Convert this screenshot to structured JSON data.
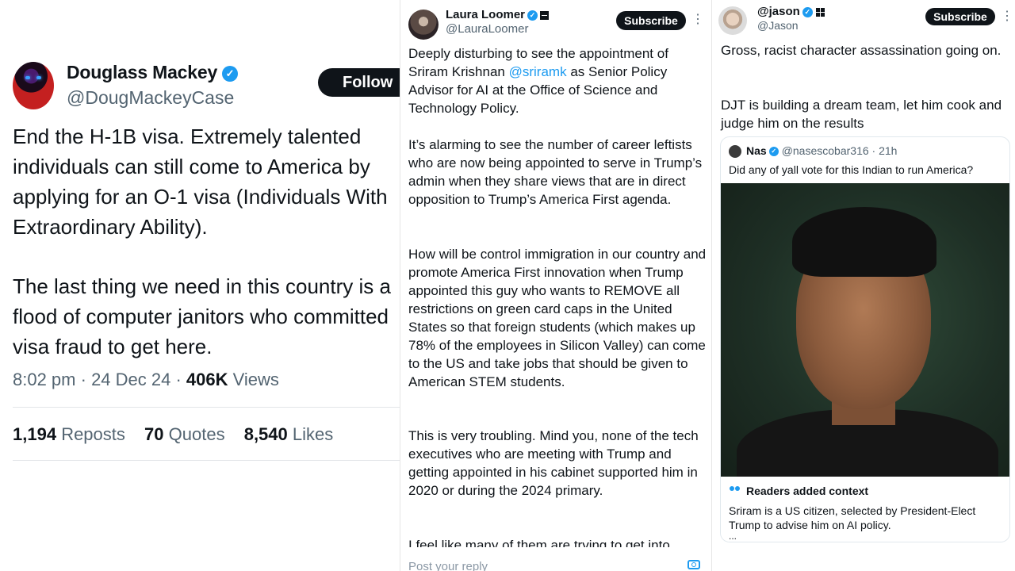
{
  "panel1": {
    "author_name": "Douglass Mackey",
    "author_handle": "@DougMackeyCase",
    "follow_label": "Follow",
    "text_paragraph_1": "End the H-1B visa. Extremely talented individuals can still come to America by applying for an O-1 visa (Individuals With Extraordinary Ability).",
    "text_paragraph_2": "The last thing we need in this country is a flood of computer janitors who committed visa fraud to get here.",
    "meta_time": "8:02 pm",
    "meta_date": "24 Dec 24",
    "views_count": "406K",
    "views_label": "Views",
    "reposts_count": "1,194",
    "reposts_label": "Reposts",
    "quotes_count": "70",
    "quotes_label": "Quotes",
    "likes_count": "8,540",
    "likes_label": "Likes"
  },
  "panel2": {
    "author_name": "Laura Loomer",
    "author_handle": "@LauraLoomer",
    "subscribe_label": "Subscribe",
    "p1_before": "Deeply disturbing to see the appointment of Sriram Krishnan ",
    "p1_mention": "@sriramk",
    "p1_after": " as Senior Policy Advisor for AI at the Office of Science and Technology Policy.",
    "p2": "It’s alarming to see the number of career leftists who are now being appointed to serve in Trump’s admin when they share views that are in direct opposition to Trump’s America First agenda.",
    "p3": "How will be control immigration in our country and promote America First innovation when Trump appointed this guy who wants to REMOVE all restrictions on green card caps in the United States so that foreign students (which makes up 78% of the employees in Silicon Valley) can come to the US and take jobs that should be given to American STEM students.",
    "p4": "This is very troubling. Mind you, none of the tech executives who are meeting with Trump and getting appointed in his cabinet supported him in 2020 or during the 2024 primary.",
    "p5": "I feel like many of them are trying to get into",
    "reply_placeholder": "Post your reply"
  },
  "panel3": {
    "author_name": "@jason",
    "author_handle": "@Jason",
    "subscribe_label": "Subscribe",
    "p1": "Gross, racist character assassination going on.",
    "p2": "DJT is building a dream team, let him cook and judge him on the results",
    "quote": {
      "author_name": "Nas",
      "author_handle": "@nasescobar316",
      "time": "21h",
      "text": "Did any of yall vote for this Indian to run America?"
    },
    "context_title": "Readers added context",
    "context_text": "Sriram is a US citizen, selected by President-Elect Trump to advise him on AI policy.",
    "context_more": "..."
  },
  "colors": {
    "accent": "#1d9bf0",
    "text": "#0f1419",
    "muted": "#536471"
  },
  "icons": [
    "verified-badge-icon",
    "more-dots-icon",
    "camera-icon",
    "people-icon",
    "grid-badge-icon"
  ]
}
